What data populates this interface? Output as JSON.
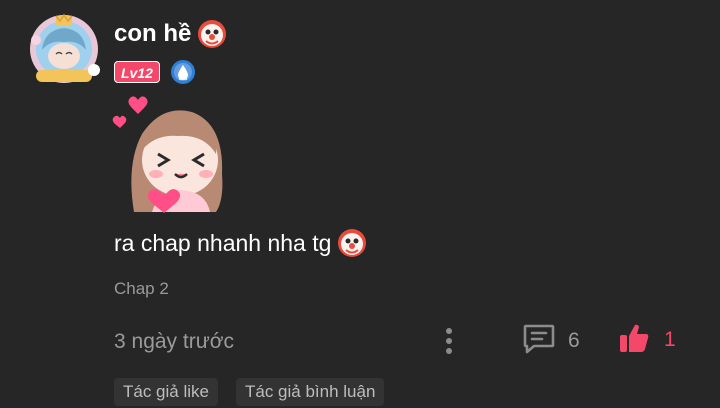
{
  "user": {
    "name": "con hề",
    "name_emoji": "clown-face-icon",
    "level": "Lv12",
    "rank_icon": "water-drop-rank-icon"
  },
  "comment": {
    "sticker": "girl-holding-heart-sticker",
    "text": "ra chap nhanh nha tg",
    "text_emoji": "clown-face-icon",
    "chapter": "Chap 2",
    "time": "3 ngày trước"
  },
  "actions": {
    "more_icon": "vertical-dots-icon",
    "reply_icon": "comment-icon",
    "reply_count": "6",
    "like_icon": "thumbs-up-icon",
    "like_count": "1"
  },
  "tags": [
    "Tác giả like",
    "Tác giả bình luận"
  ],
  "colors": {
    "background": "#262626",
    "accent": "#f4486b",
    "muted_text": "#9a9a9a",
    "tag_background": "#333333"
  }
}
